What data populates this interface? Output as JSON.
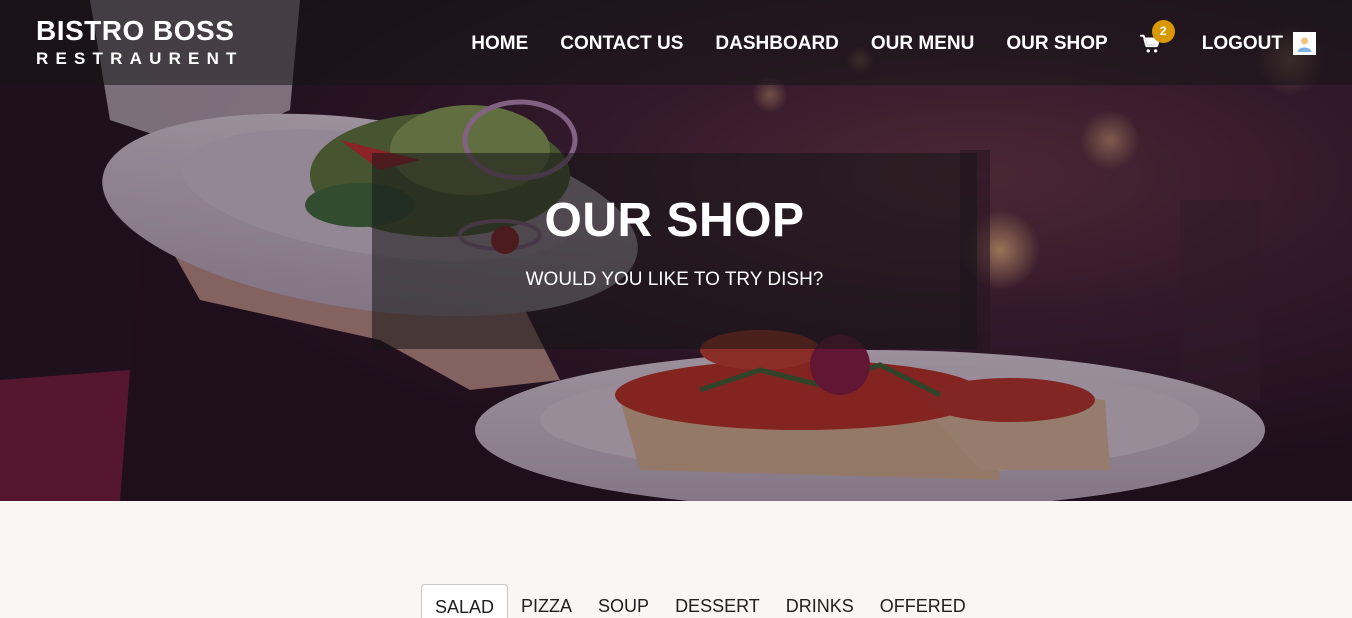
{
  "brand": {
    "title": "BISTRO BOSS",
    "subtitle": "RESTRAURENT"
  },
  "nav": {
    "items": [
      {
        "label": "HOME"
      },
      {
        "label": "CONTACT US"
      },
      {
        "label": "DASHBOARD"
      },
      {
        "label": "OUR MENU"
      },
      {
        "label": "OUR SHOP"
      }
    ],
    "cart_count": "2",
    "cart_icon": "cart-icon",
    "logout_label": "LOGOUT",
    "avatar_icon": "user-avatar-icon"
  },
  "hero": {
    "title": "OUR SHOP",
    "subtitle": "WOULD YOU LIKE TO TRY DISH?",
    "image": "waiter-holding-salad-and-bruschetta-plates"
  },
  "tabs": {
    "items": [
      {
        "label": "SALAD",
        "active": true
      },
      {
        "label": "PIZZA"
      },
      {
        "label": "SOUP"
      },
      {
        "label": "DESSERT"
      },
      {
        "label": "DRINKS"
      },
      {
        "label": "OFFERED"
      }
    ]
  },
  "colors": {
    "accent": "#d99904",
    "page_bg": "#f9f6f3",
    "overlay": "#151515"
  }
}
